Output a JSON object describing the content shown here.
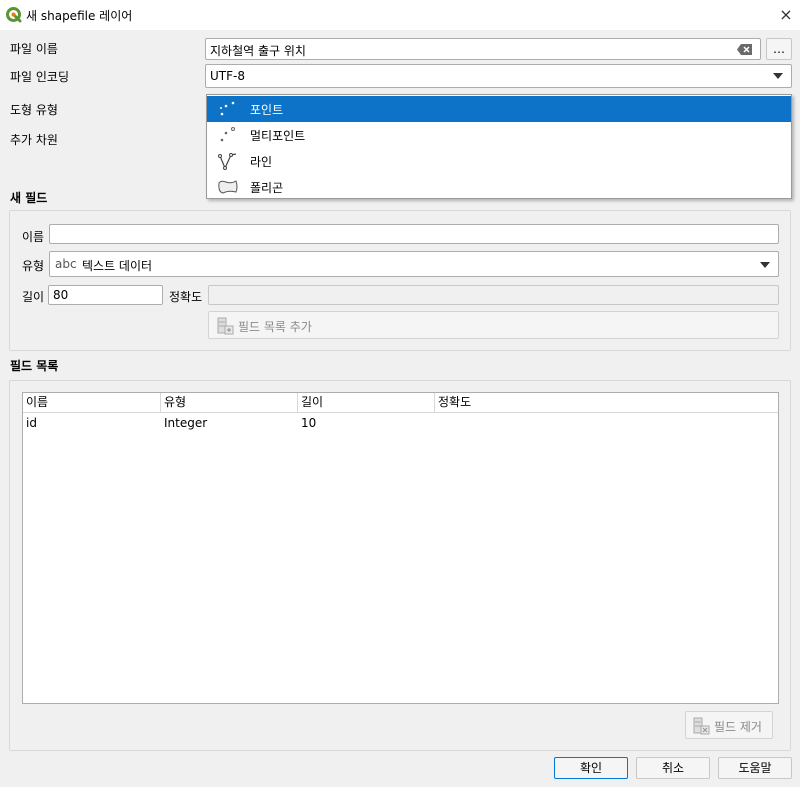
{
  "window": {
    "title": "새 shapefile 레이어",
    "close_glyph": "×"
  },
  "form": {
    "file_name_label": "파일 이름",
    "file_name_value": "지하철역 출구 위치",
    "browse_label": "…",
    "encoding_label": "파일 인코딩",
    "encoding_value": "UTF-8",
    "geometry_type_label": "도형 유형",
    "extra_dims_label": "추가 차원"
  },
  "geometry_dropdown": {
    "items": [
      {
        "label": "포인트",
        "icon": "point-icon",
        "selected": true
      },
      {
        "label": "멀티포인트",
        "icon": "multipoint-icon",
        "selected": false
      },
      {
        "label": "라인",
        "icon": "line-icon",
        "selected": false
      },
      {
        "label": "폴리곤",
        "icon": "polygon-icon",
        "selected": false
      }
    ]
  },
  "new_field": {
    "section_title": "새 필드",
    "name_label": "이름",
    "name_value": "",
    "type_label": "유형",
    "type_prefix": "abc",
    "type_value": "텍스트 데이터",
    "length_label": "길이",
    "length_value": "80",
    "precision_label": "정확도",
    "precision_value": "",
    "add_button_label": "필드 목록 추가"
  },
  "field_list": {
    "section_title": "필드 목록",
    "columns": [
      "이름",
      "유형",
      "길이",
      "정확도"
    ],
    "rows": [
      [
        "id",
        "Integer",
        "10",
        ""
      ]
    ],
    "remove_button_label": "필드 제거"
  },
  "buttons": {
    "ok": "확인",
    "cancel": "취소",
    "help": "도움말"
  },
  "colors": {
    "selection": "#0c73c8",
    "qgis_green": "#589632",
    "qgis_yellow": "#ee7913"
  }
}
